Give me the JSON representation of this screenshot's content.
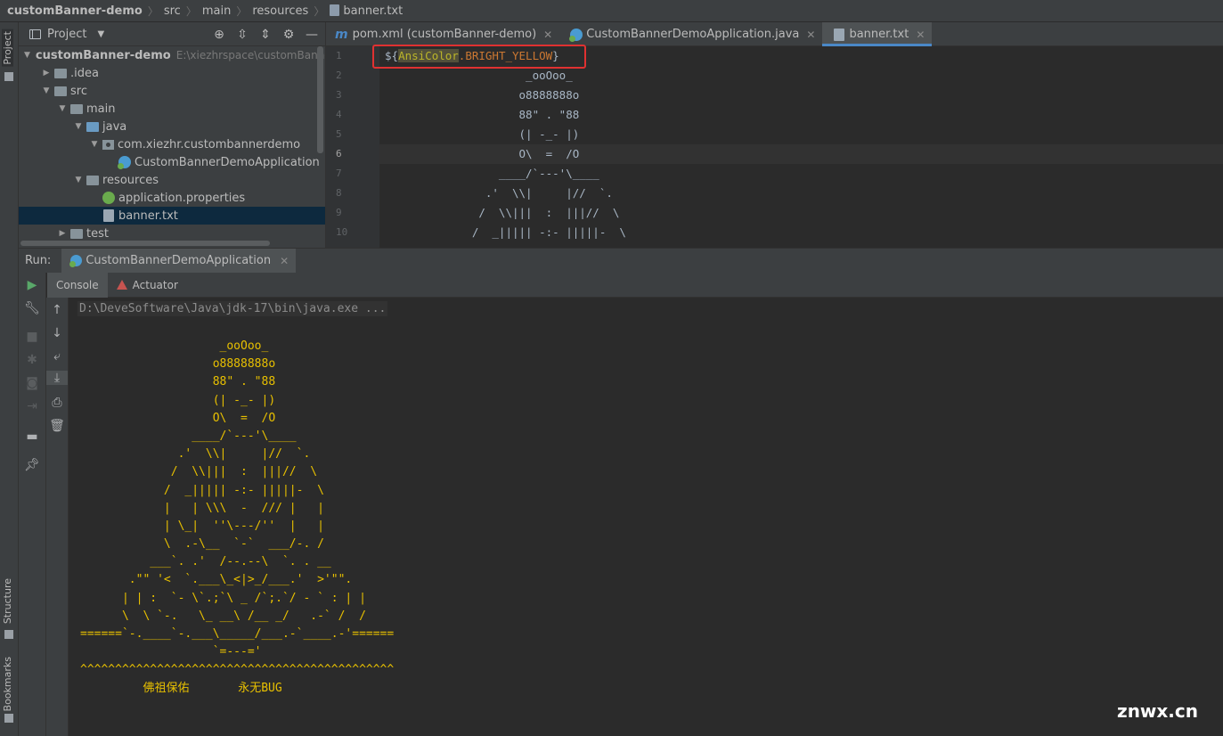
{
  "breadcrumb": [
    "customBanner-demo",
    "src",
    "main",
    "resources",
    "banner.txt"
  ],
  "left_strip": {
    "project_tab": "Project",
    "structure_tab": "Structure",
    "bookmarks_tab": "Bookmarks"
  },
  "project_panel": {
    "title": "Project",
    "tree": [
      {
        "label": "customBanner-demo",
        "hint": "E:\\xiezhrspace\\customBanne",
        "icon": "folder-icon",
        "depth": 0,
        "arrow": "down",
        "bold": true
      },
      {
        "label": ".idea",
        "icon": "folder-icon",
        "depth": 1,
        "arrow": "right"
      },
      {
        "label": "src",
        "icon": "folder-icon",
        "depth": 1,
        "arrow": "down"
      },
      {
        "label": "main",
        "icon": "folder-icon",
        "depth": 2,
        "arrow": "down"
      },
      {
        "label": "java",
        "icon": "source-folder-icon",
        "depth": 3,
        "arrow": "down"
      },
      {
        "label": "com.xiezhr.custombannerdemo",
        "icon": "package-icon",
        "depth": 4,
        "arrow": "down"
      },
      {
        "label": "CustomBannerDemoApplication",
        "icon": "spring-class-icon",
        "depth": 5,
        "arrow": ""
      },
      {
        "label": "resources",
        "icon": "resources-folder-icon",
        "depth": 3,
        "arrow": "down"
      },
      {
        "label": "application.properties",
        "icon": "properties-icon",
        "depth": 4,
        "arrow": ""
      },
      {
        "label": "banner.txt",
        "icon": "text-file-icon",
        "depth": 4,
        "arrow": "",
        "selected": true
      },
      {
        "label": "test",
        "icon": "folder-icon",
        "depth": 2,
        "arrow": "right"
      }
    ]
  },
  "editor_tabs": [
    {
      "label": "pom.xml (customBanner-demo)",
      "icon": "maven-icon",
      "active": false
    },
    {
      "label": "CustomBannerDemoApplication.java",
      "icon": "spring-class-icon",
      "active": false
    },
    {
      "label": "banner.txt",
      "icon": "text-file-icon",
      "active": true
    }
  ],
  "editor": {
    "line_numbers": [
      "1",
      "2",
      "3",
      "4",
      "5",
      "6",
      "7",
      "8",
      "9",
      "10"
    ],
    "current_line": 6,
    "first_line": {
      "prefix": "${",
      "class_token": "AnsiColor",
      "dot": ".",
      "const_token": "BRIGHT_YELLOW",
      "suffix": "}"
    },
    "lines": [
      "                     _ooOoo_",
      "                    o8888888o",
      "                    88\" . \"88",
      "                    (| -_- |)",
      "                    O\\  =  /O",
      "                 ____/`---'\\____",
      "               .'  \\\\|     |//  `.",
      "              /  \\\\|||  :  |||//  \\",
      "             /  _||||| -:- |||||-  \\"
    ]
  },
  "run": {
    "label": "Run:",
    "config_name": "CustomBannerDemoApplication",
    "subtabs": [
      "Console",
      "Actuator"
    ],
    "command": "D:\\DeveSoftware\\Java\\jdk-17\\bin\\java.exe ...",
    "banner_lines": [
      "                    _ooOoo_",
      "                   o8888888o",
      "                   88\" . \"88",
      "                   (| -_- |)",
      "                   O\\  =  /O",
      "                ____/`---'\\____",
      "              .'  \\\\|     |//  `.",
      "             /  \\\\|||  :  |||//  \\",
      "            /  _||||| -:- |||||-  \\",
      "            |   | \\\\\\  -  /// |   |",
      "            | \\_|  ''\\---/''  |   |",
      "            \\  .-\\__  `-`  ___/-. /",
      "          ___`. .'  /--.--\\  `. . __",
      "       .\"\" '<  `.___\\_<|>_/___.'  >'\"\".",
      "      | | :  `- \\`.;`\\ _ /`;.`/ - ` : | |",
      "      \\  \\ `-.   \\_ __\\ /__ _/   .-` /  /",
      "======`-.____`-.___\\_____/___.-`____.-'======",
      "                   `=---='",
      "^^^^^^^^^^^^^^^^^^^^^^^^^^^^^^^^^^^^^^^^^^^^^",
      "         佛祖保佑       永无BUG"
    ]
  },
  "watermark": "znwx.cn",
  "colors": {
    "banner_yellow": "#e8c000",
    "highlight_box": "#e03131",
    "accent": "#4a88c7"
  }
}
